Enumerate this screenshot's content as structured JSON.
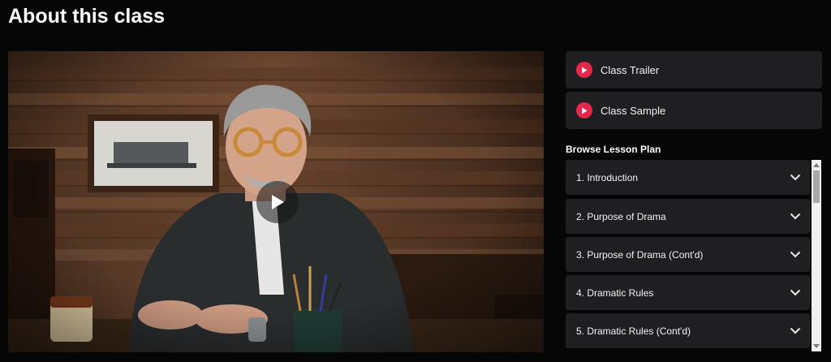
{
  "page": {
    "title": "About this class"
  },
  "video": {
    "play_icon": "play-icon",
    "progress": 0
  },
  "samples": [
    {
      "label": "Class Trailer",
      "icon": "play-circle-icon"
    },
    {
      "label": "Class Sample",
      "icon": "play-circle-icon"
    }
  ],
  "lesson_plan": {
    "heading": "Browse Lesson Plan",
    "items": [
      {
        "label": "1. Introduction"
      },
      {
        "label": "2. Purpose of Drama"
      },
      {
        "label": "3. Purpose of Drama (Cont'd)"
      },
      {
        "label": "4. Dramatic Rules"
      },
      {
        "label": "5. Dramatic Rules (Cont'd)"
      }
    ]
  },
  "colors": {
    "accent": "#e3284b",
    "card_bg": "#1f1f22",
    "page_bg": "#060606"
  }
}
